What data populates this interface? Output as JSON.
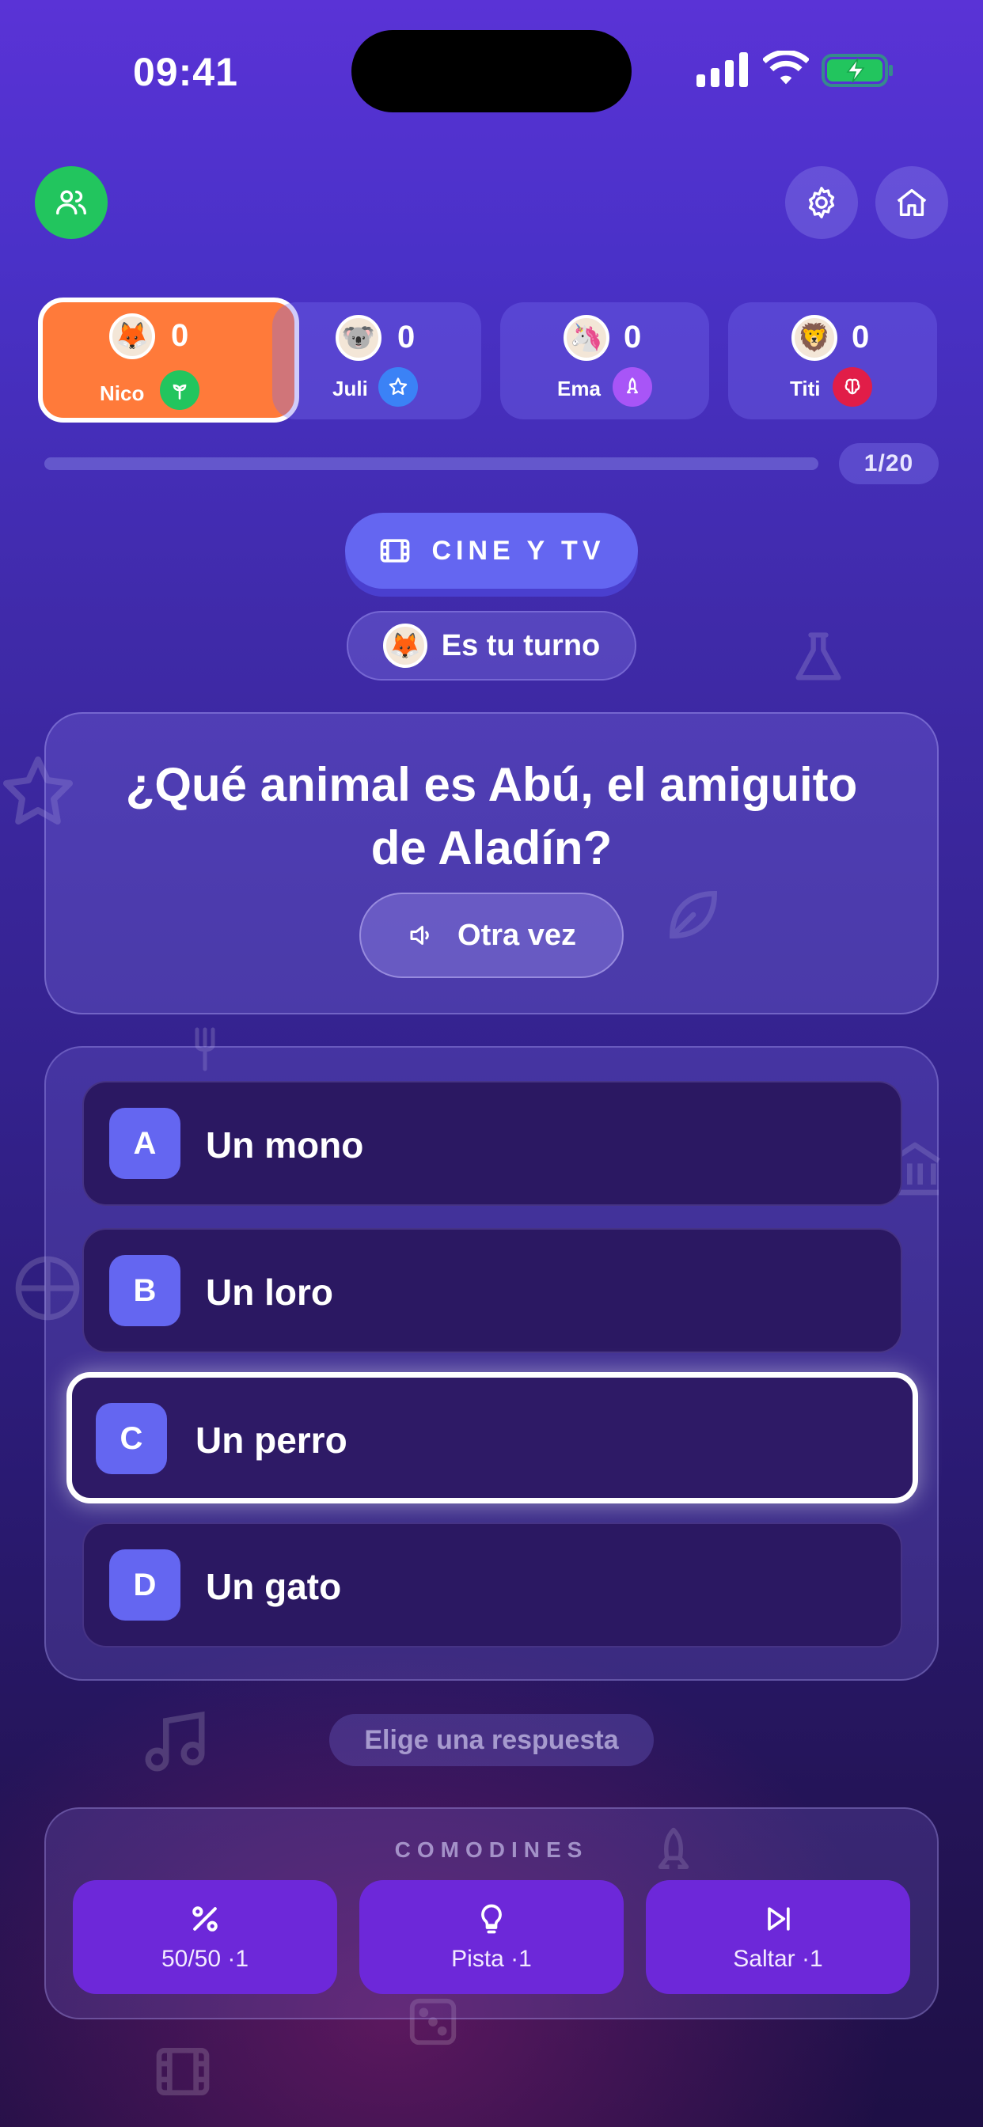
{
  "status_bar": {
    "time": "09:41"
  },
  "header": {
    "players_icon": "users-icon",
    "settings_icon": "gear-icon",
    "home_icon": "home-icon"
  },
  "players": [
    {
      "name": "Nico",
      "score": "0",
      "avatar": "🦊",
      "badge_icon": "sprout-icon",
      "badge_color": "#22c55e",
      "active": true
    },
    {
      "name": "Juli",
      "score": "0",
      "avatar": "🐨",
      "badge_icon": "star-icon",
      "badge_color": "#3b82f6",
      "active": false
    },
    {
      "name": "Ema",
      "score": "0",
      "avatar": "🦄",
      "badge_icon": "rocket-icon",
      "badge_color": "#a855f7",
      "active": false
    },
    {
      "name": "Titi",
      "score": "0",
      "avatar": "🦁",
      "badge_icon": "brain-icon",
      "badge_color": "#e11d48",
      "active": false
    }
  ],
  "progress": {
    "counter": "1/20",
    "fraction": 0.0
  },
  "category": {
    "label": "CINE Y TV",
    "icon": "film-icon"
  },
  "turn": {
    "label": "Es tu turno",
    "avatar": "🦊"
  },
  "question": {
    "text": "¿Qué animal es Abú, el amiguito de Aladín?",
    "replay_label": "Otra vez",
    "replay_icon": "speaker-icon"
  },
  "answers": [
    {
      "letter": "A",
      "text": "Un mono",
      "selected": false
    },
    {
      "letter": "B",
      "text": "Un loro",
      "selected": false
    },
    {
      "letter": "C",
      "text": "Un perro",
      "selected": true
    },
    {
      "letter": "D",
      "text": "Un gato",
      "selected": false
    }
  ],
  "hint": "Elige una respuesta",
  "lifelines": {
    "title": "COMODINES",
    "items": [
      {
        "label": "50/50 ·1",
        "icon": "percent-icon"
      },
      {
        "label": "Pista ·1",
        "icon": "lightbulb-icon"
      },
      {
        "label": "Saltar ·1",
        "icon": "skip-icon"
      }
    ]
  },
  "colors": {
    "accent": "#6466f1",
    "active_player": "#ff7a3a",
    "lifeline": "#6d28d9",
    "players_button": "#22c55e"
  }
}
